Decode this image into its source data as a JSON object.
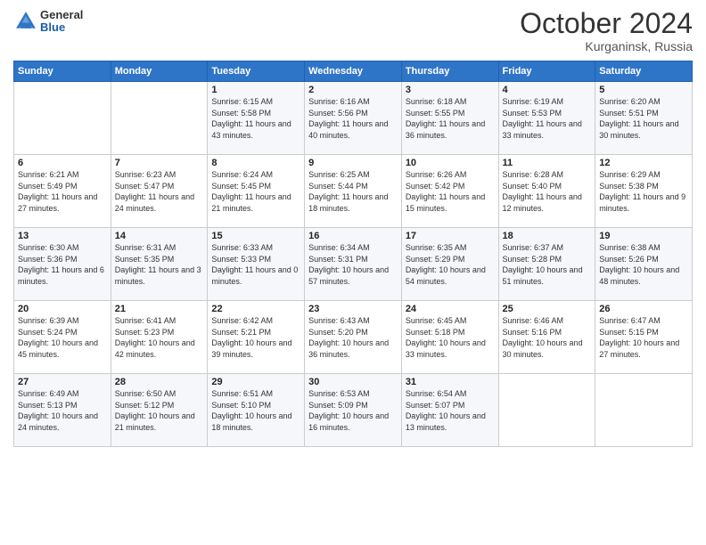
{
  "logo": {
    "general": "General",
    "blue": "Blue"
  },
  "header": {
    "month": "October 2024",
    "location": "Kurganinsk, Russia"
  },
  "days_of_week": [
    "Sunday",
    "Monday",
    "Tuesday",
    "Wednesday",
    "Thursday",
    "Friday",
    "Saturday"
  ],
  "weeks": [
    [
      null,
      null,
      {
        "day": 1,
        "sunrise": "Sunrise: 6:15 AM",
        "sunset": "Sunset: 5:58 PM",
        "daylight": "Daylight: 11 hours and 43 minutes."
      },
      {
        "day": 2,
        "sunrise": "Sunrise: 6:16 AM",
        "sunset": "Sunset: 5:56 PM",
        "daylight": "Daylight: 11 hours and 40 minutes."
      },
      {
        "day": 3,
        "sunrise": "Sunrise: 6:18 AM",
        "sunset": "Sunset: 5:55 PM",
        "daylight": "Daylight: 11 hours and 36 minutes."
      },
      {
        "day": 4,
        "sunrise": "Sunrise: 6:19 AM",
        "sunset": "Sunset: 5:53 PM",
        "daylight": "Daylight: 11 hours and 33 minutes."
      },
      {
        "day": 5,
        "sunrise": "Sunrise: 6:20 AM",
        "sunset": "Sunset: 5:51 PM",
        "daylight": "Daylight: 11 hours and 30 minutes."
      }
    ],
    [
      {
        "day": 6,
        "sunrise": "Sunrise: 6:21 AM",
        "sunset": "Sunset: 5:49 PM",
        "daylight": "Daylight: 11 hours and 27 minutes."
      },
      {
        "day": 7,
        "sunrise": "Sunrise: 6:23 AM",
        "sunset": "Sunset: 5:47 PM",
        "daylight": "Daylight: 11 hours and 24 minutes."
      },
      {
        "day": 8,
        "sunrise": "Sunrise: 6:24 AM",
        "sunset": "Sunset: 5:45 PM",
        "daylight": "Daylight: 11 hours and 21 minutes."
      },
      {
        "day": 9,
        "sunrise": "Sunrise: 6:25 AM",
        "sunset": "Sunset: 5:44 PM",
        "daylight": "Daylight: 11 hours and 18 minutes."
      },
      {
        "day": 10,
        "sunrise": "Sunrise: 6:26 AM",
        "sunset": "Sunset: 5:42 PM",
        "daylight": "Daylight: 11 hours and 15 minutes."
      },
      {
        "day": 11,
        "sunrise": "Sunrise: 6:28 AM",
        "sunset": "Sunset: 5:40 PM",
        "daylight": "Daylight: 11 hours and 12 minutes."
      },
      {
        "day": 12,
        "sunrise": "Sunrise: 6:29 AM",
        "sunset": "Sunset: 5:38 PM",
        "daylight": "Daylight: 11 hours and 9 minutes."
      }
    ],
    [
      {
        "day": 13,
        "sunrise": "Sunrise: 6:30 AM",
        "sunset": "Sunset: 5:36 PM",
        "daylight": "Daylight: 11 hours and 6 minutes."
      },
      {
        "day": 14,
        "sunrise": "Sunrise: 6:31 AM",
        "sunset": "Sunset: 5:35 PM",
        "daylight": "Daylight: 11 hours and 3 minutes."
      },
      {
        "day": 15,
        "sunrise": "Sunrise: 6:33 AM",
        "sunset": "Sunset: 5:33 PM",
        "daylight": "Daylight: 11 hours and 0 minutes."
      },
      {
        "day": 16,
        "sunrise": "Sunrise: 6:34 AM",
        "sunset": "Sunset: 5:31 PM",
        "daylight": "Daylight: 10 hours and 57 minutes."
      },
      {
        "day": 17,
        "sunrise": "Sunrise: 6:35 AM",
        "sunset": "Sunset: 5:29 PM",
        "daylight": "Daylight: 10 hours and 54 minutes."
      },
      {
        "day": 18,
        "sunrise": "Sunrise: 6:37 AM",
        "sunset": "Sunset: 5:28 PM",
        "daylight": "Daylight: 10 hours and 51 minutes."
      },
      {
        "day": 19,
        "sunrise": "Sunrise: 6:38 AM",
        "sunset": "Sunset: 5:26 PM",
        "daylight": "Daylight: 10 hours and 48 minutes."
      }
    ],
    [
      {
        "day": 20,
        "sunrise": "Sunrise: 6:39 AM",
        "sunset": "Sunset: 5:24 PM",
        "daylight": "Daylight: 10 hours and 45 minutes."
      },
      {
        "day": 21,
        "sunrise": "Sunrise: 6:41 AM",
        "sunset": "Sunset: 5:23 PM",
        "daylight": "Daylight: 10 hours and 42 minutes."
      },
      {
        "day": 22,
        "sunrise": "Sunrise: 6:42 AM",
        "sunset": "Sunset: 5:21 PM",
        "daylight": "Daylight: 10 hours and 39 minutes."
      },
      {
        "day": 23,
        "sunrise": "Sunrise: 6:43 AM",
        "sunset": "Sunset: 5:20 PM",
        "daylight": "Daylight: 10 hours and 36 minutes."
      },
      {
        "day": 24,
        "sunrise": "Sunrise: 6:45 AM",
        "sunset": "Sunset: 5:18 PM",
        "daylight": "Daylight: 10 hours and 33 minutes."
      },
      {
        "day": 25,
        "sunrise": "Sunrise: 6:46 AM",
        "sunset": "Sunset: 5:16 PM",
        "daylight": "Daylight: 10 hours and 30 minutes."
      },
      {
        "day": 26,
        "sunrise": "Sunrise: 6:47 AM",
        "sunset": "Sunset: 5:15 PM",
        "daylight": "Daylight: 10 hours and 27 minutes."
      }
    ],
    [
      {
        "day": 27,
        "sunrise": "Sunrise: 6:49 AM",
        "sunset": "Sunset: 5:13 PM",
        "daylight": "Daylight: 10 hours and 24 minutes."
      },
      {
        "day": 28,
        "sunrise": "Sunrise: 6:50 AM",
        "sunset": "Sunset: 5:12 PM",
        "daylight": "Daylight: 10 hours and 21 minutes."
      },
      {
        "day": 29,
        "sunrise": "Sunrise: 6:51 AM",
        "sunset": "Sunset: 5:10 PM",
        "daylight": "Daylight: 10 hours and 18 minutes."
      },
      {
        "day": 30,
        "sunrise": "Sunrise: 6:53 AM",
        "sunset": "Sunset: 5:09 PM",
        "daylight": "Daylight: 10 hours and 16 minutes."
      },
      {
        "day": 31,
        "sunrise": "Sunrise: 6:54 AM",
        "sunset": "Sunset: 5:07 PM",
        "daylight": "Daylight: 10 hours and 13 minutes."
      },
      null,
      null
    ]
  ]
}
